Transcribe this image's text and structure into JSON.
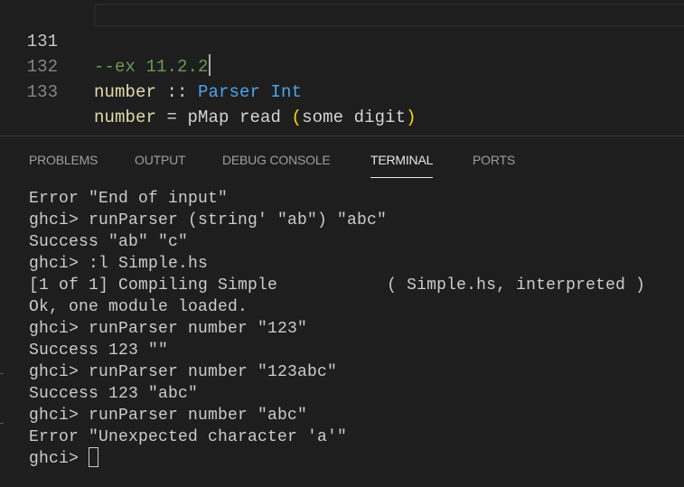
{
  "editor": {
    "lines": [
      {
        "number": "131",
        "tokens": [
          {
            "text": "--ex 11.2.2",
            "kind": "comment"
          }
        ]
      },
      {
        "number": "132",
        "tokens": [
          {
            "text": "number",
            "kind": "fn"
          },
          {
            "text": " :: ",
            "kind": "plain"
          },
          {
            "text": "Parser Int",
            "kind": "type"
          }
        ]
      },
      {
        "number": "133",
        "tokens": [
          {
            "text": "number",
            "kind": "fn"
          },
          {
            "text": " = pMap read ",
            "kind": "plain"
          },
          {
            "text": "(",
            "kind": "paren"
          },
          {
            "text": "some digit",
            "kind": "plain"
          },
          {
            "text": ")",
            "kind": "paren"
          }
        ]
      }
    ]
  },
  "panel": {
    "tabs": [
      {
        "label": "PROBLEMS",
        "active": false
      },
      {
        "label": "OUTPUT",
        "active": false
      },
      {
        "label": "DEBUG CONSOLE",
        "active": false
      },
      {
        "label": "TERMINAL",
        "active": true
      },
      {
        "label": "PORTS",
        "active": false
      }
    ]
  },
  "terminal": {
    "lines": [
      "Error \"End of input\"",
      "ghci> runParser (string' \"ab\") \"abc\"",
      "Success \"ab\" \"c\"",
      "ghci> :l Simple.hs",
      "[1 of 1] Compiling Simple           ( Simple.hs, interpreted )",
      "Ok, one module loaded.",
      "ghci> runParser number \"123\"",
      "Success 123 \"\"",
      "ghci> runParser number \"123abc\"",
      "Success 123 \"abc\"",
      "ghci> runParser number \"abc\"",
      "Error \"Unexpected character 'a'\""
    ],
    "prompt": "ghci> "
  },
  "colors": {
    "background": "#1e1e1e",
    "comment": "#6a9955",
    "function": "#dcdcaa",
    "type": "#4fa3e8",
    "bracket": "#ffd700"
  }
}
